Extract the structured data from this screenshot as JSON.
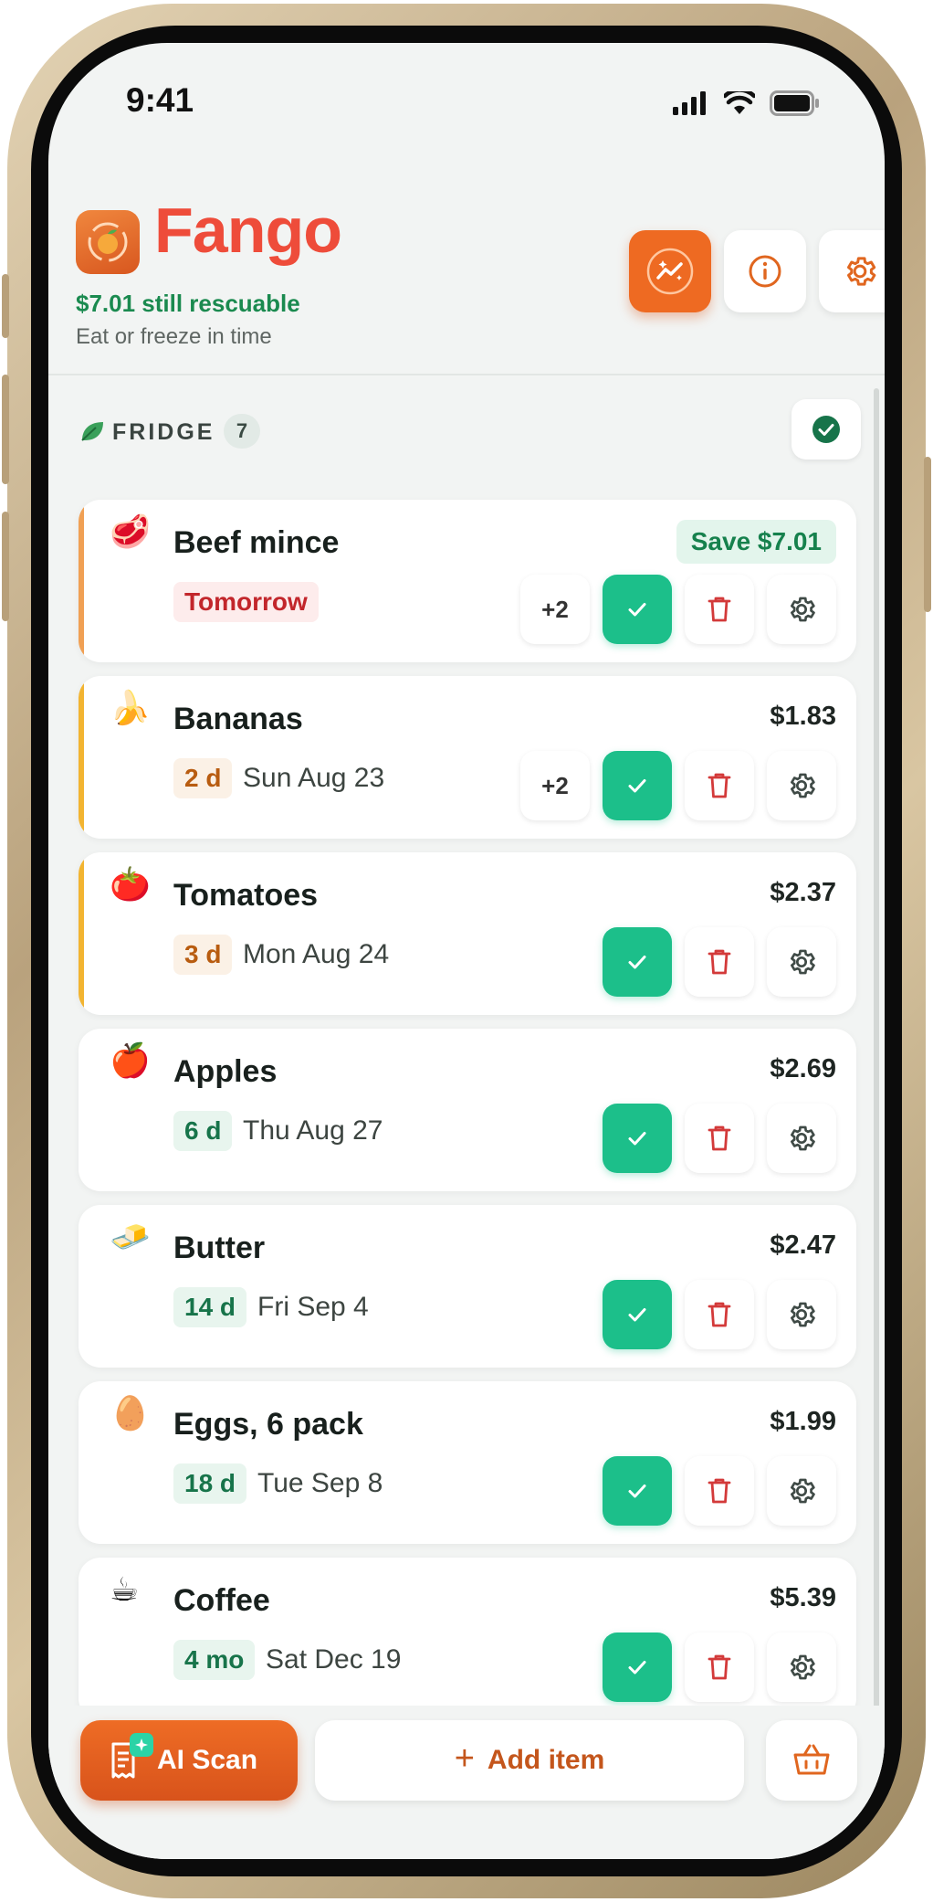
{
  "status_bar": {
    "time": "9:41"
  },
  "header": {
    "app_name": "Fango",
    "rescuable": "$7.01 still rescuable",
    "tagline": "Eat or freeze in time"
  },
  "section": {
    "title": "FRIDGE",
    "count": "7"
  },
  "items": [
    {
      "emoji": "🥩",
      "name": "Beef mince",
      "save": "Save $7.01",
      "days": "Tomorrow",
      "days_tone": "red",
      "date": "",
      "more": "+2",
      "urgency": "#f0a054"
    },
    {
      "emoji": "🍌",
      "name": "Bananas",
      "price": "$1.83",
      "days": "2 d",
      "days_tone": "amber",
      "date": "Sun Aug 23",
      "more": "+2",
      "urgency": "#f2b431"
    },
    {
      "emoji": "🍅",
      "name": "Tomatoes",
      "price": "$2.37",
      "days": "3 d",
      "days_tone": "amber",
      "date": "Mon Aug 24",
      "urgency": "#f2b431"
    },
    {
      "emoji": "🍎",
      "name": "Apples",
      "price": "$2.69",
      "days": "6 d",
      "days_tone": "green",
      "date": "Thu Aug 27"
    },
    {
      "emoji": "🧈",
      "name": "Butter",
      "price": "$2.47",
      "days": "14 d",
      "days_tone": "green",
      "date": "Fri Sep 4"
    },
    {
      "emoji": "🥚",
      "name": "Eggs, 6 pack",
      "price": "$1.99",
      "days": "18 d",
      "days_tone": "green",
      "date": "Tue Sep 8"
    },
    {
      "emoji": "☕",
      "name": "Coffee",
      "price": "$5.39",
      "days": "4 mo",
      "days_tone": "green",
      "date": "Sat Dec 19"
    }
  ],
  "bottom_bar": {
    "ai_scan_label": "AI Scan",
    "add_item_label": "Add item"
  },
  "icons": {
    "header": [
      "insights-icon",
      "info-icon",
      "gear-icon"
    ],
    "item_actions": [
      "check-icon",
      "trash-icon",
      "gear-icon"
    ],
    "bottom": [
      "receipt-scan-icon",
      "basket-icon"
    ]
  },
  "colors": {
    "brand": "#ee4c3a",
    "accent_orange": "#ee6a22",
    "check_green": "#1cbf8a",
    "trash_red": "#d33a3a",
    "rescue_green": "#1a8a4f"
  }
}
